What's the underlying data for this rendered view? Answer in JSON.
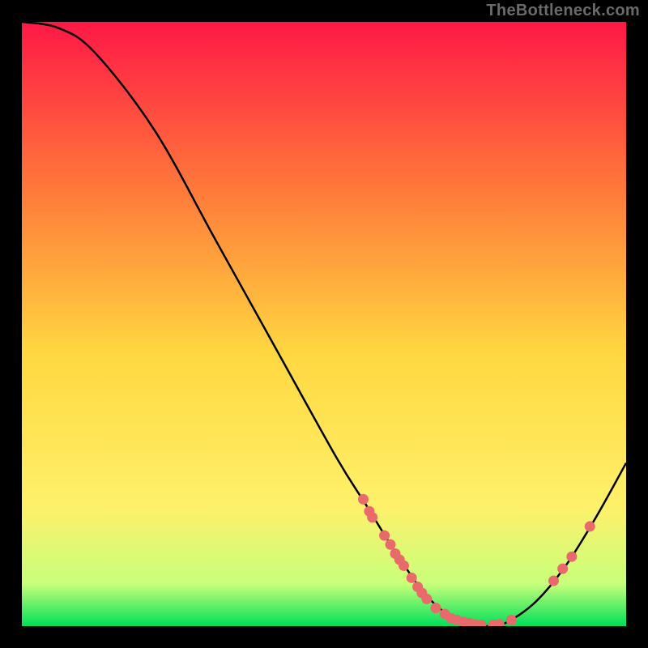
{
  "watermark": "TheBottleneck.com",
  "colors": {
    "gradient_top": "#ff1846",
    "gradient_mid_upper": "#ff7a3a",
    "gradient_mid": "#ffd840",
    "gradient_mid_lower": "#fff06a",
    "gradient_green_hint": "#c8ff7a",
    "gradient_bottom": "#00e05a",
    "curve": "#000000",
    "point": "#e86a6a"
  },
  "chart_data": {
    "type": "line",
    "title": "",
    "xlabel": "",
    "ylabel": "",
    "xlim": [
      0,
      100
    ],
    "ylim": [
      0,
      100
    ],
    "curve": [
      {
        "x": 0,
        "y": 100
      },
      {
        "x": 6,
        "y": 99
      },
      {
        "x": 12,
        "y": 95
      },
      {
        "x": 22,
        "y": 82
      },
      {
        "x": 32,
        "y": 64
      },
      {
        "x": 42,
        "y": 46
      },
      {
        "x": 52,
        "y": 28
      },
      {
        "x": 57,
        "y": 20
      },
      {
        "x": 62,
        "y": 12
      },
      {
        "x": 67,
        "y": 5
      },
      {
        "x": 72,
        "y": 1
      },
      {
        "x": 77,
        "y": 0
      },
      {
        "x": 80,
        "y": 0.5
      },
      {
        "x": 85,
        "y": 4
      },
      {
        "x": 90,
        "y": 10
      },
      {
        "x": 95,
        "y": 18
      },
      {
        "x": 100,
        "y": 27
      }
    ],
    "series": [
      {
        "name": "points",
        "values": [
          {
            "x": 56.5,
            "y": 21.0
          },
          {
            "x": 57.5,
            "y": 19.0
          },
          {
            "x": 58.0,
            "y": 18.0
          },
          {
            "x": 60.0,
            "y": 15.0
          },
          {
            "x": 61.0,
            "y": 13.5
          },
          {
            "x": 61.8,
            "y": 12.0
          },
          {
            "x": 62.5,
            "y": 11.0
          },
          {
            "x": 63.2,
            "y": 10.0
          },
          {
            "x": 64.5,
            "y": 8.0
          },
          {
            "x": 65.5,
            "y": 6.5
          },
          {
            "x": 66.2,
            "y": 5.5
          },
          {
            "x": 67.0,
            "y": 4.5
          },
          {
            "x": 68.5,
            "y": 3.0
          },
          {
            "x": 70.0,
            "y": 2.0
          },
          {
            "x": 71.0,
            "y": 1.3
          },
          {
            "x": 72.0,
            "y": 1.0
          },
          {
            "x": 73.0,
            "y": 0.7
          },
          {
            "x": 74.0,
            "y": 0.5
          },
          {
            "x": 75.0,
            "y": 0.3
          },
          {
            "x": 76.0,
            "y": 0.2
          },
          {
            "x": 78.0,
            "y": 0.2
          },
          {
            "x": 79.0,
            "y": 0.3
          },
          {
            "x": 81.0,
            "y": 1.0
          },
          {
            "x": 88.0,
            "y": 7.5
          },
          {
            "x": 89.5,
            "y": 9.5
          },
          {
            "x": 91.0,
            "y": 11.5
          },
          {
            "x": 94.0,
            "y": 16.5
          }
        ]
      }
    ]
  }
}
